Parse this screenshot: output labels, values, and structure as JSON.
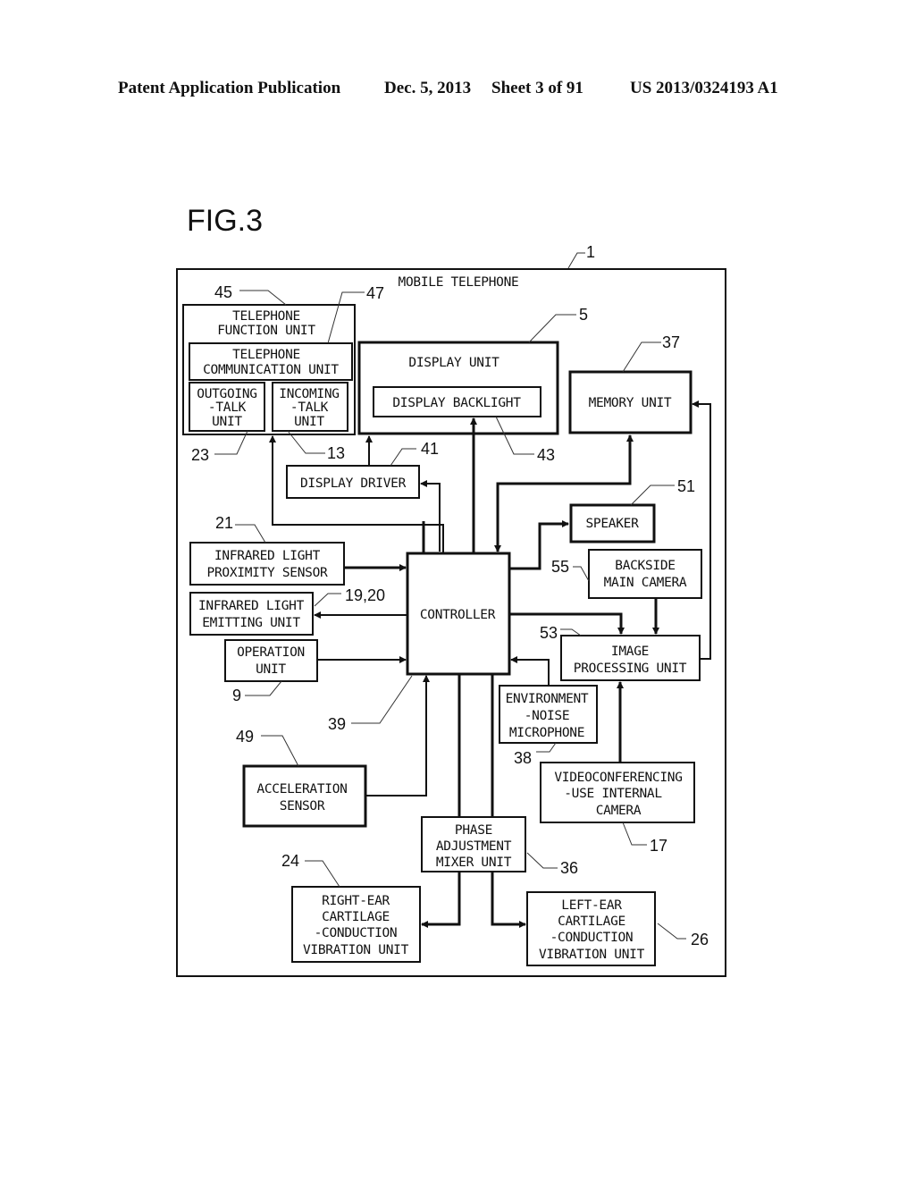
{
  "header": {
    "publication": "Patent Application Publication",
    "date": "Dec. 5, 2013",
    "sheet": "Sheet 3 of 91",
    "patent_number": "US 2013/0324193 A1"
  },
  "figure": {
    "title": "FIG.3",
    "outer": {
      "label": "MOBILE TELEPHONE",
      "ref": "1"
    },
    "blocks": {
      "telephone_function": {
        "lines": [
          "TELEPHONE",
          "FUNCTION UNIT"
        ],
        "ref": "45"
      },
      "telephone_communication": {
        "lines": [
          "TELEPHONE",
          "COMMUNICATION UNIT"
        ],
        "ref": "47"
      },
      "outgoing_talk": {
        "lines": [
          "OUTGOING",
          "-TALK",
          "UNIT"
        ],
        "ref": "23"
      },
      "incoming_talk": {
        "lines": [
          "INCOMING",
          "-TALK",
          "UNIT"
        ],
        "ref": "13"
      },
      "display_unit": {
        "lines": [
          "DISPLAY UNIT"
        ],
        "ref": "5"
      },
      "display_backlight": {
        "lines": [
          "DISPLAY BACKLIGHT"
        ],
        "ref": "43"
      },
      "memory_unit": {
        "lines": [
          "MEMORY UNIT"
        ],
        "ref": "37"
      },
      "display_driver": {
        "lines": [
          "DISPLAY DRIVER"
        ],
        "ref": "41"
      },
      "speaker": {
        "lines": [
          "SPEAKER"
        ],
        "ref": "51"
      },
      "infrared_proximity": {
        "lines": [
          "INFRARED LIGHT",
          "PROXIMITY SENSOR"
        ],
        "ref": "21"
      },
      "backside_camera": {
        "lines": [
          "BACKSIDE",
          "MAIN CAMERA"
        ],
        "ref": "55"
      },
      "infrared_emitting": {
        "lines": [
          "INFRARED LIGHT",
          "EMITTING UNIT"
        ],
        "ref": "19,20"
      },
      "controller": {
        "lines": [
          "CONTROLLER"
        ],
        "ref": "39"
      },
      "image_processing": {
        "lines": [
          "IMAGE",
          "PROCESSING UNIT"
        ],
        "ref": "53"
      },
      "operation_unit": {
        "lines": [
          "OPERATION",
          "UNIT"
        ],
        "ref": "9"
      },
      "environment_mic": {
        "lines": [
          "ENVIRONMENT",
          "-NOISE",
          "MICROPHONE"
        ],
        "ref": "38"
      },
      "acceleration_sensor": {
        "lines": [
          "ACCELERATION",
          "SENSOR"
        ],
        "ref": "49"
      },
      "video_camera": {
        "lines": [
          "VIDEOCONFERENCING",
          "-USE INTERNAL",
          "CAMERA"
        ],
        "ref": "17"
      },
      "phase_mixer": {
        "lines": [
          "PHASE",
          "ADJUSTMENT",
          "MIXER UNIT"
        ],
        "ref": "36"
      },
      "right_ear": {
        "lines": [
          "RIGHT-EAR",
          "CARTILAGE",
          "-CONDUCTION",
          "VIBRATION UNIT"
        ],
        "ref": "24"
      },
      "left_ear": {
        "lines": [
          "LEFT-EAR",
          "CARTILAGE",
          "-CONDUCTION",
          "VIBRATION UNIT"
        ],
        "ref": "26"
      }
    }
  }
}
